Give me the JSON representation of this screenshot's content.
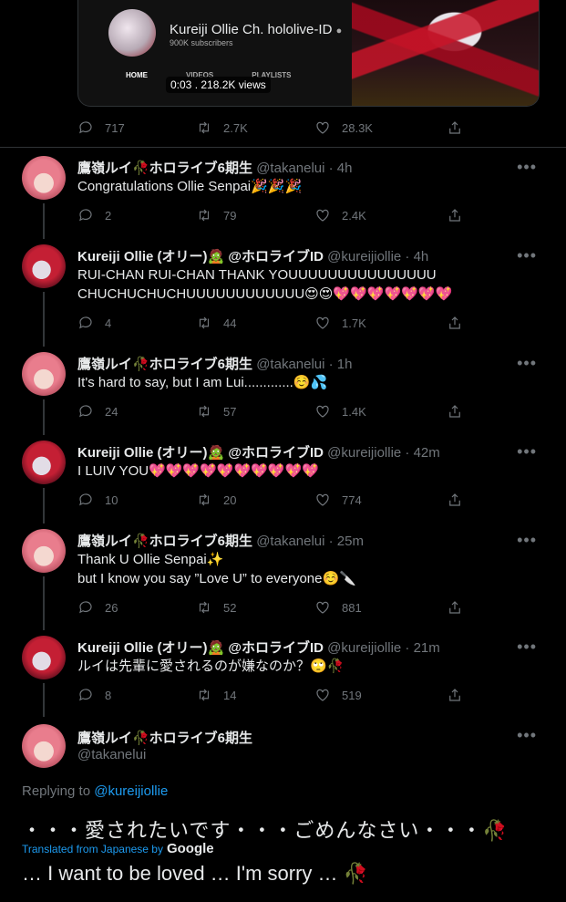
{
  "embed": {
    "channel_name": "Kureiji Ollie Ch. hololive-ID",
    "verified_mark": "●",
    "subscribers": "900K subscribers",
    "tabs": [
      "HOME",
      "VIDEOS",
      "PLAYLISTS"
    ],
    "timestamp_views": "0:03 . 218.2K views"
  },
  "top_actions": {
    "replies": "717",
    "retweets": "2.7K",
    "likes": "28.3K"
  },
  "tweets": [
    {
      "name": "鷹嶺ルイ🥀ホロライブ6期生",
      "handle": "@takanelui · 4h",
      "avatar": "lui",
      "lines": [
        "Congratulations Ollie Senpai🎉🎉🎉"
      ],
      "replies": "2",
      "retweets": "79",
      "likes": "2.4K"
    },
    {
      "name": "Kureiji Ollie (オリー)🧟 @ホロライブID",
      "handle": "@kureijiollie · 4h",
      "avatar": "ollie",
      "lines": [
        "RUI-CHAN RUI-CHAN THANK YOUUUUUUUUUUUUUUU",
        "CHUCHUCHUCHUUUUUUUUUUUU😍😍💖💖💖💖💖💖💖"
      ],
      "replies": "4",
      "retweets": "44",
      "likes": "1.7K"
    },
    {
      "name": "鷹嶺ルイ🥀ホロライブ6期生",
      "handle": "@takanelui · 1h",
      "avatar": "lui",
      "lines": [
        "It's hard to say, but I am Lui.............☺️💦"
      ],
      "replies": "24",
      "retweets": "57",
      "likes": "1.4K"
    },
    {
      "name": "Kureiji Ollie (オリー)🧟 @ホロライブID",
      "handle": "@kureijiollie · 42m",
      "avatar": "ollie",
      "lines": [
        "I LUIV YOU💖💖💖💖💖💖💖💖💖💖"
      ],
      "replies": "10",
      "retweets": "20",
      "likes": "774"
    },
    {
      "name": "鷹嶺ルイ🥀ホロライブ6期生",
      "handle": "@takanelui · 25m",
      "avatar": "lui",
      "lines": [
        "Thank U Ollie Senpai✨",
        "but I know you say ”Love U” to everyone☺️🔪"
      ],
      "replies": "26",
      "retweets": "52",
      "likes": "881"
    },
    {
      "name": "Kureiji Ollie (オリー)🧟 @ホロライブID",
      "handle": "@kureijiollie · 21m",
      "avatar": "ollie",
      "lines": [
        "ルイは先輩に愛されるのが嫌なのか？🙄🥀"
      ],
      "replies": "8",
      "retweets": "14",
      "likes": "519"
    }
  ],
  "focused": {
    "name": "鷹嶺ルイ🥀ホロライブ6期生",
    "handle": "@takanelui",
    "replying_prefix": "Replying to",
    "replying_to": "@kureijiollie",
    "original_text": "・・・愛されたいです・・・ごめんなさい・・・🥀",
    "translated_label": "Translated from Japanese by",
    "translator": "Google",
    "translation": "… I want to be loved … I'm sorry … 🥀"
  },
  "more_label": "•••"
}
